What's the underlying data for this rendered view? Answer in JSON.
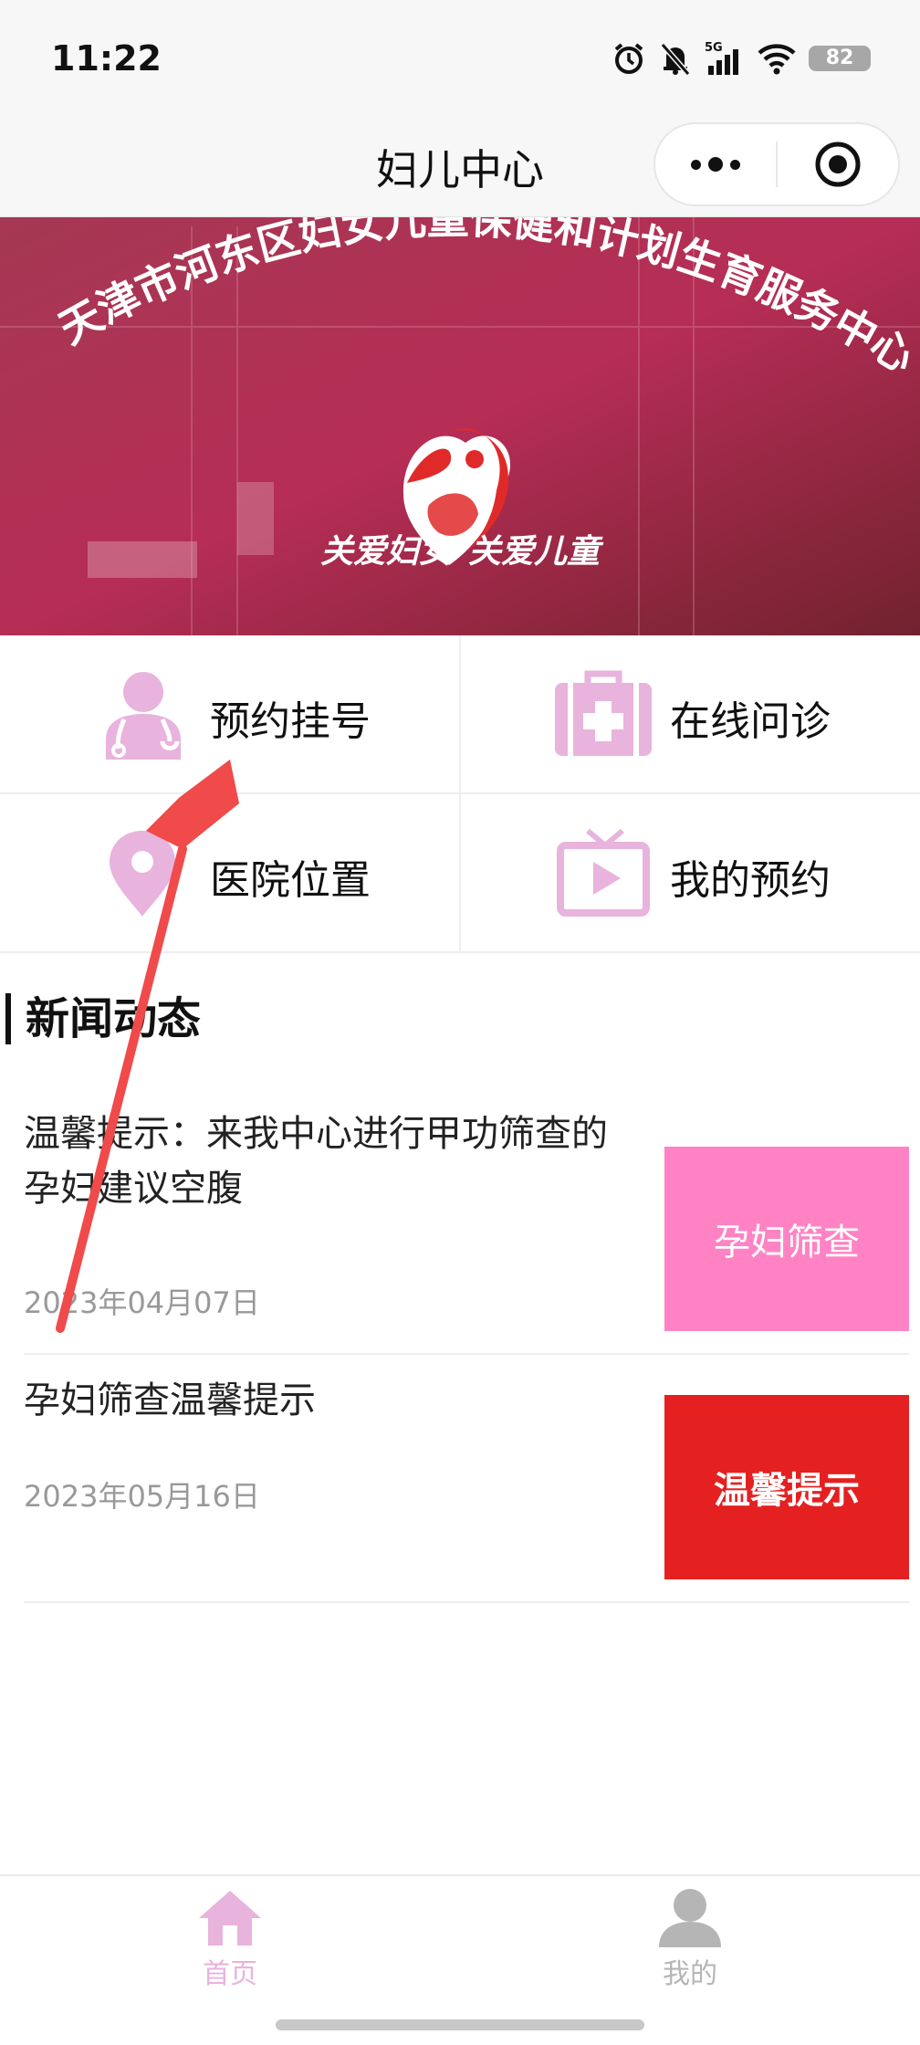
{
  "status_bar": {
    "time": "11:22",
    "battery": "82",
    "network": "5G"
  },
  "nav": {
    "title": "妇儿中心"
  },
  "banner": {
    "org_name": "天津市河东区妇女儿童保健和计划生育服务中心",
    "slogan": "关爱妇女  关爱儿童"
  },
  "menu": {
    "items": [
      {
        "label": "预约挂号",
        "icon": "doctor-icon"
      },
      {
        "label": "在线问诊",
        "icon": "medical-kit-icon"
      },
      {
        "label": "医院位置",
        "icon": "location-pin-icon"
      },
      {
        "label": "我的预约",
        "icon": "tv-play-icon"
      }
    ],
    "icon_color": "#e8b3dc"
  },
  "news": {
    "header": "新闻动态",
    "items": [
      {
        "title": "温馨提示：来我中心进行甲功筛查的孕妇建议空腹",
        "date": "2023年04月07日",
        "thumb_text": "孕妇筛查",
        "thumb_color": "#ff83c4"
      },
      {
        "title": "孕妇筛查温馨提示",
        "date": "2023年05月16日",
        "thumb_text": "温馨提示",
        "thumb_color": "#e42021"
      }
    ]
  },
  "tabbar": {
    "items": [
      {
        "label": "首页",
        "icon": "home-icon",
        "active": true
      },
      {
        "label": "我的",
        "icon": "user-icon",
        "active": false
      }
    ],
    "active_color": "#e8b3dc",
    "inactive_color": "#b5b5b5"
  },
  "colors": {
    "annotation_arrow": "#f04a4a",
    "banner_bg": "#8c1836"
  }
}
